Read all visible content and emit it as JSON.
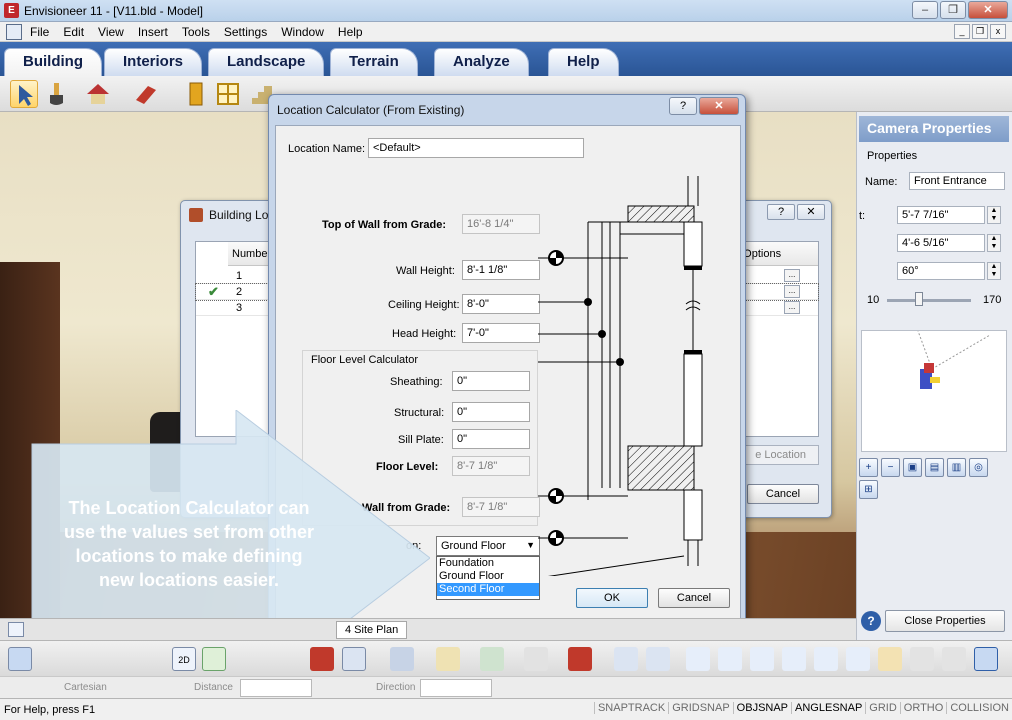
{
  "window": {
    "title": "Envisioneer 11 - [V11.bld - Model]"
  },
  "menu": [
    "File",
    "Edit",
    "View",
    "Insert",
    "Tools",
    "Settings",
    "Window",
    "Help"
  ],
  "ribbon_tabs": [
    "Building",
    "Interiors",
    "Landscape",
    "Terrain",
    "Analyze",
    "Help"
  ],
  "camera_panel": {
    "header": "Camera Properties",
    "section": "Properties",
    "name_label": "Name:",
    "name_value": "Front Entrance",
    "t_label": "t:",
    "field1": "5'-7 7/16\"",
    "field2": "4'-6 5/16\"",
    "field3": "60°",
    "slider_min": "10",
    "slider_max": "170",
    "close_label": "Close Properties"
  },
  "building_locations": {
    "title": "Building Lo",
    "col_number": "Numbe",
    "col_options": "g Options",
    "rows": [
      "1",
      "2",
      "3"
    ],
    "dots": "...",
    "set_location": "e Location",
    "cancel": "Cancel"
  },
  "location_calc": {
    "title": "Location Calculator (From Existing)",
    "location_name_label": "Location Name:",
    "location_name_value": "<Default>",
    "top_of_wall_label": "Top of Wall from Grade:",
    "top_of_wall_value": "16'-8 1/4\"",
    "wall_height_label": "Wall Height:",
    "wall_height_value": "8'-1 1/8\"",
    "ceiling_height_label": "Ceiling Height:",
    "ceiling_height_value": "8'-0\"",
    "head_height_label": "Head Height:",
    "head_height_value": "7'-0\"",
    "floor_calc_caption": "Floor Level Calculator",
    "sheathing_label": "Sheathing:",
    "sheathing_value": "0\"",
    "structural_label": "Structural:",
    "structural_value": "0\"",
    "sill_plate_label": "Sill Plate:",
    "sill_plate_value": "0\"",
    "floor_level_label": "Floor Level:",
    "floor_level_value": "8'-7 1/8\"",
    "wall_from_grade_label": "Wall from Grade:",
    "wall_from_grade_value": "8'-7 1/8\"",
    "on_label": "on:",
    "selected": "Ground Floor",
    "options": [
      "Foundation",
      "Ground Floor",
      "Second Floor"
    ],
    "ok": "OK",
    "cancel": "Cancel"
  },
  "callout": {
    "text": "The Location Calculator can use the values set from other locations to make defining new locations easier."
  },
  "bottom_tab": "4 Site Plan",
  "coord": {
    "cartesian": "Cartesian",
    "distance": "Distance",
    "direction": "Direction"
  },
  "status": {
    "help": "For Help, press F1",
    "snaps": [
      "SNAPTRACK",
      "GRIDSNAP",
      "OBJSNAP",
      "ANGLESNAP",
      "GRID",
      "ORTHO",
      "COLLISION"
    ]
  },
  "colors": {
    "ribbon": "#2a5595",
    "callout": "#d7e7f2",
    "highlight": "#3399ff"
  }
}
